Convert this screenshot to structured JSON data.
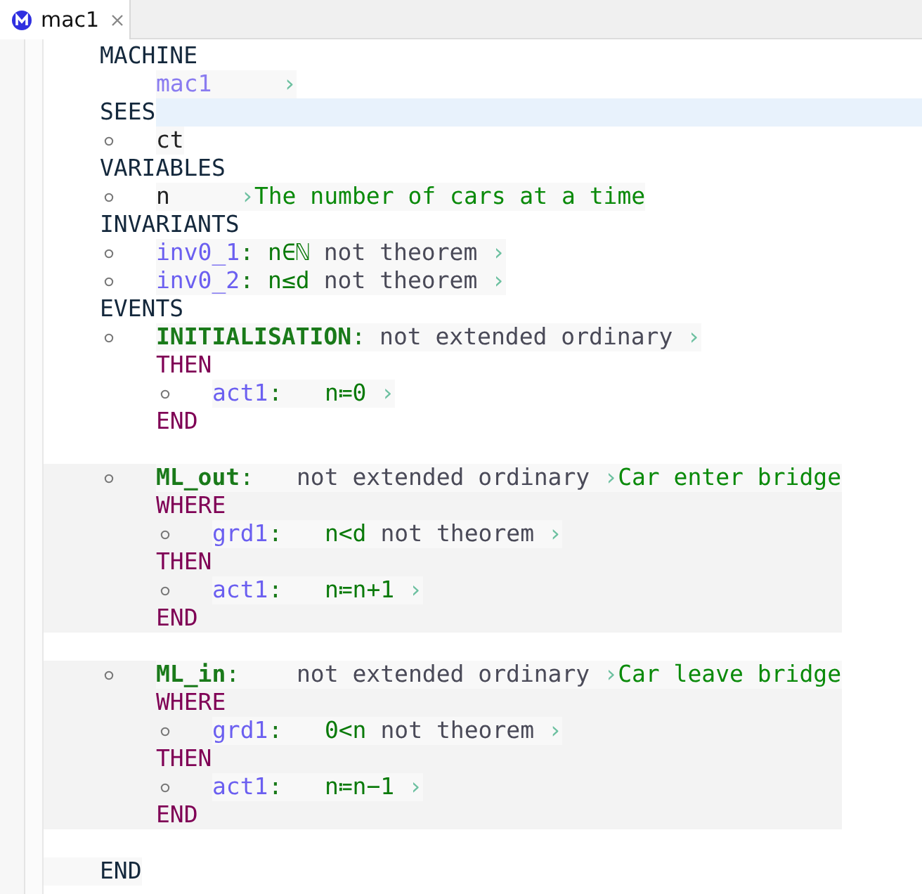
{
  "tab": {
    "title": "mac1",
    "selected": true
  },
  "clauses": [
    {
      "keyword": "MACHINE",
      "highlighted": false,
      "items": [
        {
          "kind": "name",
          "label": "mac1",
          "marker": "›"
        }
      ]
    },
    {
      "keyword": "SEES",
      "highlighted": true,
      "items": [
        {
          "kind": "context",
          "label": "ct"
        }
      ]
    },
    {
      "keyword": "VARIABLES",
      "highlighted": false,
      "items": [
        {
          "kind": "variable",
          "label": "n",
          "marker": "›",
          "comment": "The number of cars at a time"
        }
      ]
    },
    {
      "keyword": "INVARIANTS",
      "highlighted": false,
      "items": [
        {
          "kind": "invariant",
          "label": "inv0_1",
          "separator": ":",
          "predicate": "n∈ℕ",
          "attribute": "not theorem",
          "marker": "›"
        },
        {
          "kind": "invariant",
          "label": "inv0_2",
          "separator": ":",
          "predicate": "n≤d",
          "attribute": "not theorem",
          "marker": "›"
        }
      ]
    },
    {
      "keyword": "EVENTS",
      "highlighted": false,
      "items": [
        {
          "kind": "event",
          "shaded": false,
          "label": "INITIALISATION",
          "separator": ":",
          "attribute": "not extended ordinary",
          "marker": "›",
          "sections": [
            {
              "keyword": "THEN",
              "items": [
                {
                  "kind": "formula",
                  "label": "act1",
                  "separator": ":",
                  "predicate": "n≔0",
                  "marker": "›"
                }
              ]
            }
          ],
          "end": "END"
        },
        {
          "kind": "event",
          "shaded": true,
          "label": "ML_out",
          "separator": ":",
          "attribute": "not extended ordinary",
          "marker": "›",
          "comment": "Car enter bridge",
          "sections": [
            {
              "keyword": "WHERE",
              "items": [
                {
                  "kind": "formula",
                  "label": "grd1",
                  "separator": ":",
                  "predicate": "n<d",
                  "attribute": "not theorem",
                  "marker": "›"
                }
              ]
            },
            {
              "keyword": "THEN",
              "items": [
                {
                  "kind": "formula",
                  "label": "act1",
                  "separator": ":",
                  "predicate": "n≔n+1",
                  "marker": "›"
                }
              ]
            }
          ],
          "end": "END"
        },
        {
          "kind": "event",
          "shaded": true,
          "label": "ML_in",
          "separator": ":",
          "attribute": "not extended ordinary",
          "marker": "›",
          "comment": "Car leave bridge",
          "sections": [
            {
              "keyword": "WHERE",
              "items": [
                {
                  "kind": "formula",
                  "label": "grd1",
                  "separator": ":",
                  "predicate": "0<n",
                  "attribute": "not theorem",
                  "marker": "›"
                }
              ]
            },
            {
              "keyword": "THEN",
              "items": [
                {
                  "kind": "formula",
                  "label": "act1",
                  "separator": ":",
                  "predicate": "n≔n−1",
                  "marker": "›"
                }
              ]
            }
          ],
          "end": "END"
        }
      ]
    }
  ],
  "end": "END"
}
